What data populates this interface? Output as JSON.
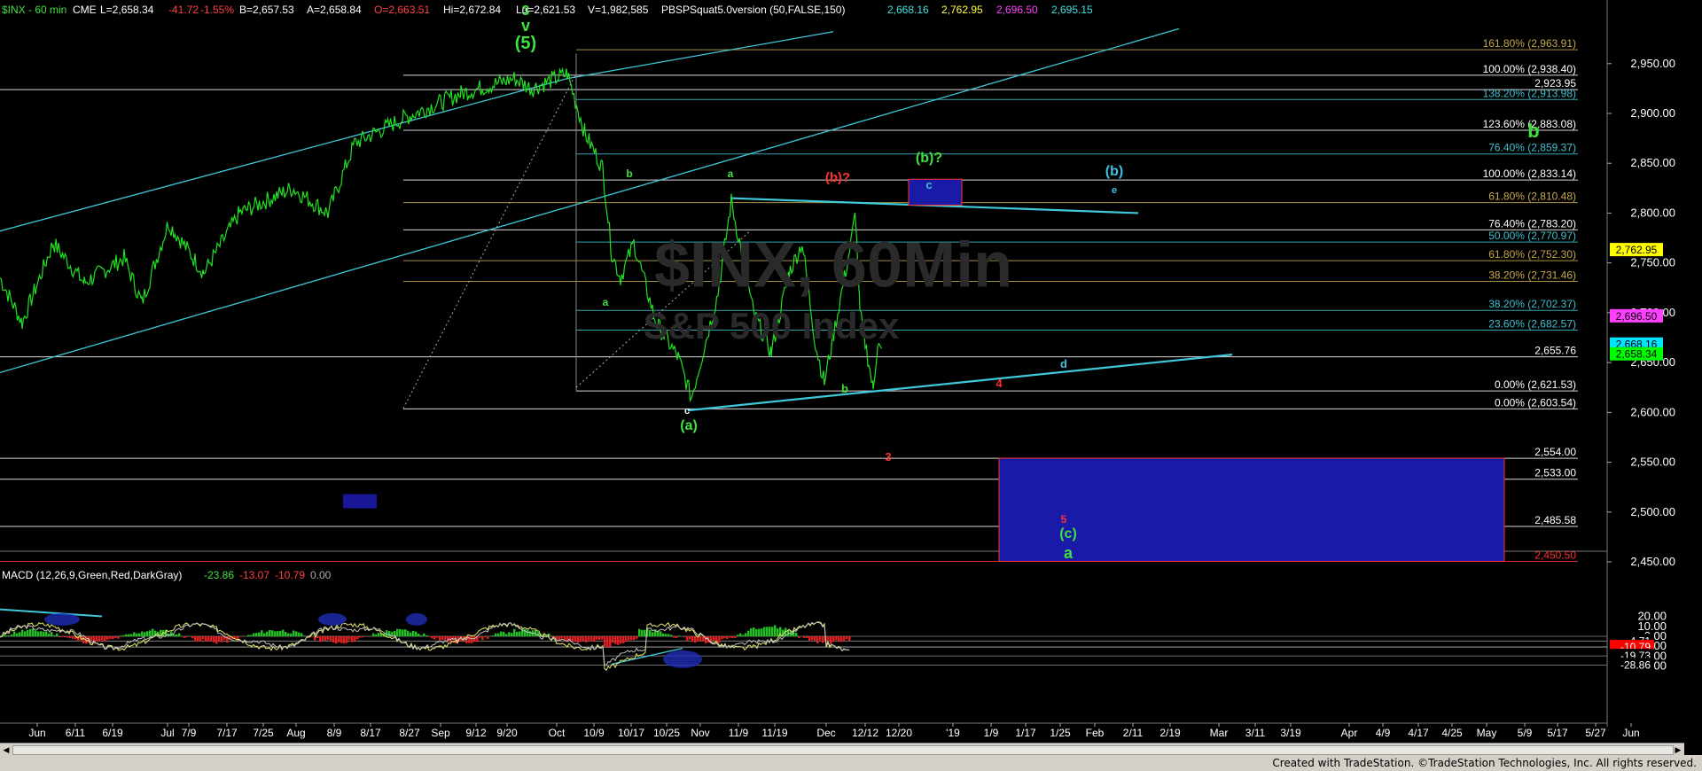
{
  "header": {
    "symbol": "$INX - 60 min",
    "exchange": "CME",
    "last": "L=2,658.34",
    "change": "-41.72",
    "pct": "-1.55%",
    "bid": "B=2,657.53",
    "ask": "A=2,658.84",
    "open": "O=2,663.51",
    "high": "Hi=2,672.84",
    "low": "Lo=2,621.53",
    "volume": "V=1,982,585",
    "indicator": "PBSPSquat5.0version (50,FALSE,150)",
    "ind_values": [
      "2,668.16",
      "2,762.95",
      "2,696.50",
      "2,695.15"
    ]
  },
  "watermark": {
    "title": "$INX, 60Min",
    "subtitle": "S&P 500 Index"
  },
  "price_axis": {
    "ticks": [
      "2,950.00",
      "2,900.00",
      "2,850.00",
      "2,800.00",
      "2,750.00",
      "2,700.00",
      "2,650.00",
      "2,600.00",
      "2,550.00",
      "2,500.00",
      "2,450.00"
    ]
  },
  "macd_axis": {
    "ticks": [
      "20.00",
      "10.00",
      "0.00",
      "-10.00",
      "-20.00",
      "-30.00"
    ]
  },
  "macd_header": {
    "label": "MACD (12,26,9,Green,Red,DarkGray)",
    "v1": "-23.86",
    "v2": "-13.07",
    "v3": "-10.79",
    "v4": "0.00"
  },
  "fib_levels": [
    {
      "label": "161.80% (2,963.91)",
      "color": "#c8a84c"
    },
    {
      "label": "100.00% (2,938.40)",
      "color": "#ffffff"
    },
    {
      "label": "2,923.95",
      "color": "#ffffff"
    },
    {
      "label": "138.20% (2,913.98)",
      "color": "#3fc0d0"
    },
    {
      "label": "123.60% (2,883.08)",
      "color": "#ffffff"
    },
    {
      "label": "76.40% (2,859.37)",
      "color": "#3fc0d0"
    },
    {
      "label": "100.00% (2,833.14)",
      "color": "#ffffff"
    },
    {
      "label": "61.80% (2,810.48)",
      "color": "#c8a84c"
    },
    {
      "label": "76.40% (2,783.20)",
      "color": "#ffffff"
    },
    {
      "label": "50.00% (2,770.97)",
      "color": "#3fc0d0"
    },
    {
      "label": "61.80% (2,752.30)",
      "color": "#c8a84c"
    },
    {
      "label": "38.20% (2,731.46)",
      "color": "#c8a84c"
    },
    {
      "label": "38.20% (2,702.37)",
      "color": "#3fc0d0"
    },
    {
      "label": "23.60% (2,682.57)",
      "color": "#3fc0d0"
    },
    {
      "label": "2,655.76",
      "color": "#ffffff"
    },
    {
      "label": "0.00% (2,621.53)",
      "color": "#ffffff"
    },
    {
      "label": "0.00% (2,603.54)",
      "color": "#ffffff"
    },
    {
      "label": "2,554.00",
      "color": "#ffffff"
    },
    {
      "label": "2,533.00",
      "color": "#ffffff"
    },
    {
      "label": "2,485.58",
      "color": "#ffffff"
    },
    {
      "label": "2,450.50",
      "color": "#ff3030"
    }
  ],
  "price_flags": [
    {
      "label": "2,762.95",
      "bg": "#ffff00",
      "fg": "#000000"
    },
    {
      "label": "2,696.50",
      "bg": "#ff40ff",
      "fg": "#000000"
    },
    {
      "label": "2,668.16",
      "bg": "#00e5ff",
      "fg": "#000000"
    },
    {
      "label": "2,658.34",
      "bg": "#00ff00",
      "fg": "#000000"
    }
  ],
  "macd_flags": [
    {
      "label": "-4.71",
      "bg": "#000000",
      "fg": "#ffffff"
    },
    {
      "label": "-10.73",
      "bg": "#000000",
      "fg": "#ffffff"
    },
    {
      "label": "-10.79",
      "bg": "#ff0000",
      "fg": "#ffffff"
    },
    {
      "label": "-19.73",
      "bg": "#000000",
      "fg": "#ffffff"
    },
    {
      "label": "-28.86",
      "bg": "#000000",
      "fg": "#ffffff"
    }
  ],
  "date_axis": [
    "Jun",
    "6/11",
    "6/19",
    "Jul",
    "7/9",
    "7/17",
    "7/25",
    "Aug",
    "8/9",
    "8/17",
    "8/27",
    "Sep",
    "9/12",
    "9/20",
    "Oct",
    "10/9",
    "10/17",
    "10/25",
    "Nov",
    "11/9",
    "11/19",
    "Dec",
    "12/12",
    "12/20",
    "'19",
    "1/9",
    "1/17",
    "1/25",
    "Feb",
    "2/11",
    "2/19",
    "Mar",
    "3/11",
    "3/19",
    "Apr",
    "4/9",
    "4/17",
    "4/25",
    "May",
    "5/9",
    "5/17",
    "5/27",
    "Jun"
  ],
  "wave_labels": [
    {
      "text": "(5)",
      "color": "#40e040"
    },
    {
      "text": "v",
      "color": "#40e040"
    },
    {
      "text": "3",
      "color": "#40e040"
    },
    {
      "text": "b",
      "color": "#40e040"
    },
    {
      "text": "a",
      "color": "#40e040"
    },
    {
      "text": "a",
      "color": "#40e040"
    },
    {
      "text": "c",
      "color": "#ffffff"
    },
    {
      "text": "(a)",
      "color": "#40e040"
    },
    {
      "text": "(b)?",
      "color": "#ff3030"
    },
    {
      "text": "b",
      "color": "#40e040"
    },
    {
      "text": "(b)?",
      "color": "#40e040"
    },
    {
      "text": "c",
      "color": "#40c0d0"
    },
    {
      "text": "(b)",
      "color": "#40c0e0"
    },
    {
      "text": "e",
      "color": "#40c0e0"
    },
    {
      "text": "d",
      "color": "#40c0e0"
    },
    {
      "text": "4",
      "color": "#ff3030"
    },
    {
      "text": "3",
      "color": "#ff3030"
    },
    {
      "text": "5",
      "color": "#ff3030"
    },
    {
      "text": "(c)",
      "color": "#40e040"
    },
    {
      "text": "a",
      "color": "#40e040"
    },
    {
      "text": "b",
      "color": "#40e040"
    }
  ],
  "footer": "Created with TradeStation. ©TradeStation Technologies, Inc. All rights reserved."
}
